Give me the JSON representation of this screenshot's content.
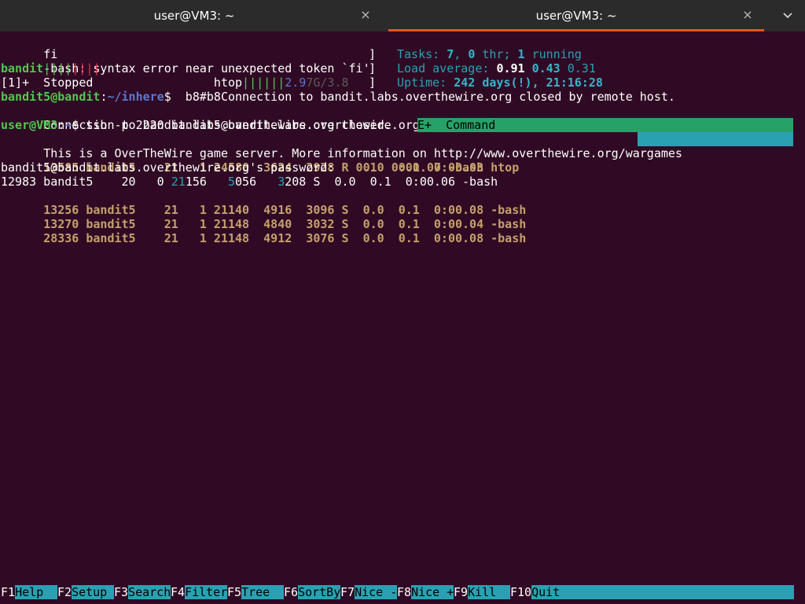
{
  "window": {
    "tabs": [
      {
        "label": "user@VM3: ~",
        "close": "×"
      },
      {
        "label": "user@VM3: ~",
        "close": "×"
      }
    ],
    "menu_icon": "chevron-down"
  },
  "term": {
    "l0": "fi",
    "l1": "-bash: syntax error near unexpected token `fi'",
    "l1_bracket": "]",
    "l1_right": {
      "tasks_label": "Tasks: ",
      "tasks": "7",
      "sep1": ", ",
      "thr": "0",
      "thr_label": " thr; ",
      "running": "1",
      "running_label": " running"
    },
    "l2_user": "bandit",
    "l2_bars_green": "||||",
    "l2_bars_red": "||||",
    "l2_bracket": "]",
    "l2_right": {
      "label": "Load average: ",
      "v1": "0.91",
      "v2": "0.43",
      "v3": "0.31"
    },
    "l3_job": "[1]+  Stopped                 htop",
    "l3_bars": "||||||",
    "l3_mem1": "2.9",
    "l3_mem2": "7G/3.8",
    "l3_bracket": "]",
    "l3_right": {
      "label": "Uptime: ",
      "days": "242 days(!)",
      "time": ", 21:16:28"
    },
    "l4_prompt_user": "bandit5@bandit",
    "l4_prompt_colon": ":",
    "l4_prompt_path": "~/inhere",
    "l4_prompt_dollar": "$  b8#b8Connection to bandit.labs.overthewire.org closed by remote host.",
    "l5": "Connection to bandit.labs.overthewire.org closed.",
    "l6_prompt_user": "user@VM3",
    "l6_prompt_colon": ":",
    "l6_prompt_path": "~",
    "l6_cmd": "$ ssh -p 2220 bandit5@bandit.labs.overthewire.org",
    "l6_header": "E+  Command",
    "l7": "This is a OverTheWire game server. More information on http://www.overthewire.org/wargames",
    "l8": "13585 bandit5    21   1 24580  3624  2928 R  0.0  0.1  0:00.03 htop",
    "l9_a": "bandit5@bandit.labs.overthewire.org's password:",
    "l9_b": "   0.1  0:00.07 -bash",
    "l10": {
      "pid": "12983 bandit5    20   0 ",
      "virt_a": "21",
      "virt_b": "156   ",
      "res_a": "5",
      "res_b": "056   ",
      "shr_a": "3",
      "shr_b": "208 S  0.0  0.1  0:00.06 -bash"
    },
    "l11": "13256 bandit5    21   1 21140  4916  3096 S  0.0  0.1  0:00.08 -bash",
    "l12": "13270 bandit5    21   1 21148  4840  3032 S  0.0  0.1  0:00.04 -bash",
    "l13": "28336 bandit5    21   1 21148  4912  3076 S  0.0  0.1  0:00.08 -bash"
  },
  "fkeys": [
    {
      "num": "F1",
      "label": "Help  "
    },
    {
      "num": "F2",
      "label": "Setup "
    },
    {
      "num": "F3",
      "label": "Search"
    },
    {
      "num": "F4",
      "label": "Filter"
    },
    {
      "num": "F5",
      "label": "Tree  "
    },
    {
      "num": "F6",
      "label": "SortBy"
    },
    {
      "num": "F7",
      "label": "Nice -"
    },
    {
      "num": "F8",
      "label": "Nice +"
    },
    {
      "num": "F9",
      "label": "Kill  "
    },
    {
      "num": "F10",
      "label": "Quit"
    }
  ],
  "colors": {
    "background": "#300a24",
    "tabbar": "#2b2b2b",
    "active_tab_indicator": "#e95420",
    "header_green": "#26a269",
    "cyan": "#2aa1b3"
  }
}
